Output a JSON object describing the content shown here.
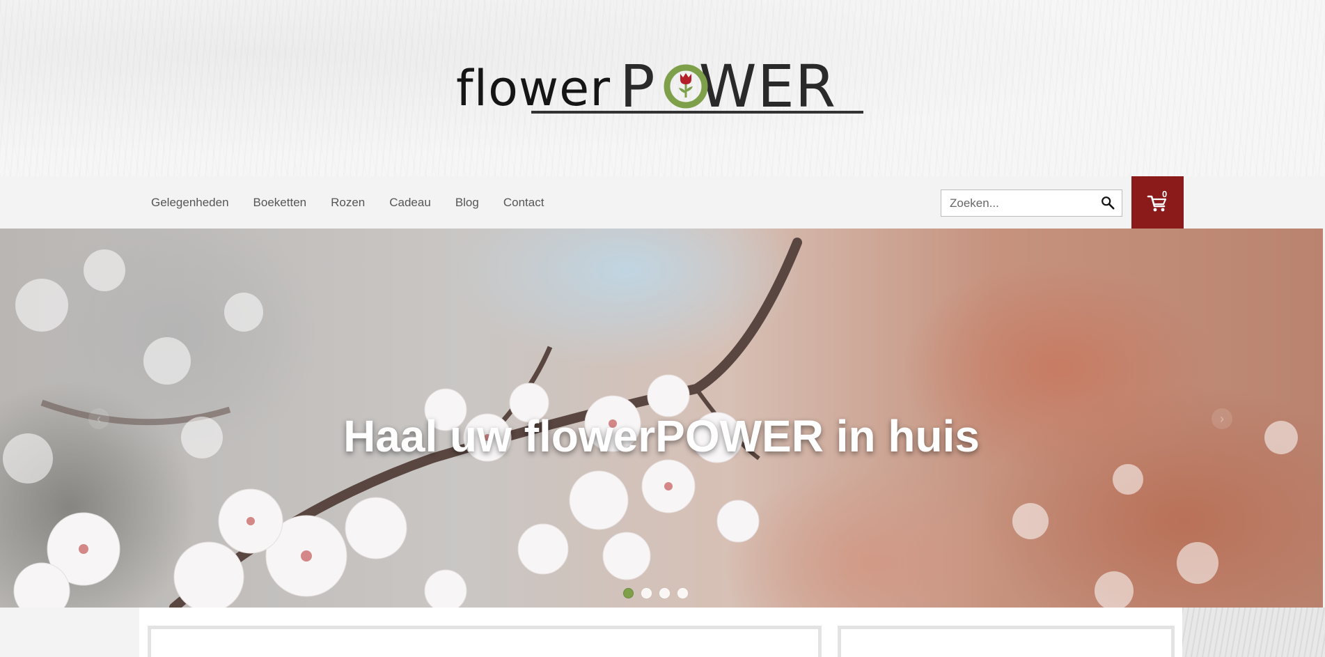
{
  "brand": {
    "logo_part1": "flower",
    "logo_part2_before": "P",
    "logo_part2_after": "WER",
    "logo_colors": {
      "green": "#7ea04a",
      "red": "#b3202a",
      "dark": "#222222"
    }
  },
  "nav": {
    "items": [
      {
        "label": "Gelegenheden"
      },
      {
        "label": "Boeketten"
      },
      {
        "label": "Rozen"
      },
      {
        "label": "Cadeau"
      },
      {
        "label": "Blog"
      },
      {
        "label": "Contact"
      }
    ]
  },
  "search": {
    "placeholder": "Zoeken...",
    "value": "",
    "icon": "search-icon"
  },
  "cart": {
    "count": "0",
    "icon": "cart-icon",
    "color": "#8b1a1a"
  },
  "hero": {
    "title": "Haal uw flowerPOWER in huis",
    "slides_total": 4,
    "active_slide": 1,
    "prev_icon": "chevron-left-icon",
    "next_icon": "chevron-right-icon",
    "accent_color": "#7ea04a"
  }
}
